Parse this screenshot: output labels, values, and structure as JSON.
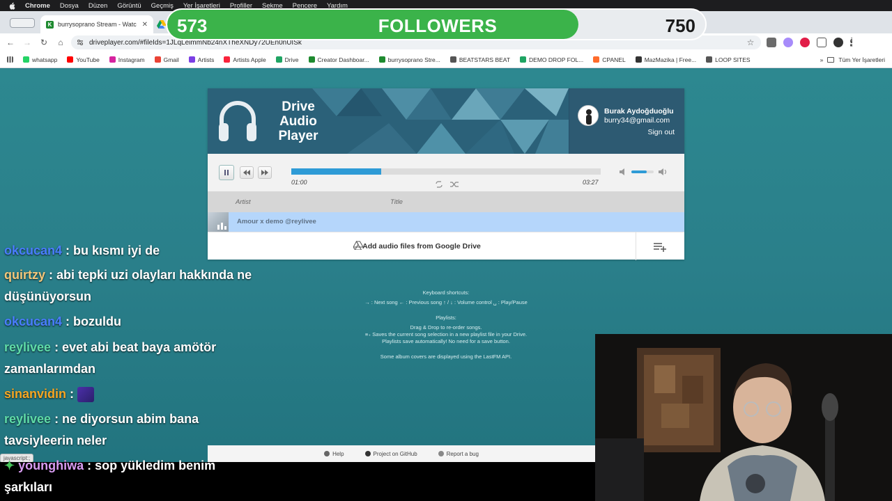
{
  "menubar": {
    "items": [
      "Chrome",
      "Dosya",
      "Düzen",
      "Görüntü",
      "Geçmiş",
      "Yer İşaretleri",
      "Profiller",
      "Sekme",
      "Pencere",
      "Yardım"
    ]
  },
  "browser": {
    "active_tab": {
      "label": "burrysoprano Stream - Watc",
      "favicon": "K"
    },
    "url": "driveplayer.com/#fileIds=1JLqLeimmNb24nXTheXNDy72UEn0nUISk",
    "bookmarks": [
      {
        "label": "whatsapp",
        "color": "#25d366"
      },
      {
        "label": "YouTube",
        "color": "#ff0000"
      },
      {
        "label": "Instagram",
        "color": "#d6249f"
      },
      {
        "label": "Gmail",
        "color": "#ea4335"
      },
      {
        "label": "Artists",
        "color": "#7b3fe4"
      },
      {
        "label": "Artists Apple",
        "color": "#fa243c"
      },
      {
        "label": "Drive",
        "color": "#1fa463"
      },
      {
        "label": "Creator Dashboar...",
        "color": "#1e8a2f"
      },
      {
        "label": "burrysoprano Stre...",
        "color": "#1e8a2f"
      },
      {
        "label": "BEATSTARS BEAT",
        "color": "#555555"
      },
      {
        "label": "DEMO DROP FOL...",
        "color": "#1fa463"
      },
      {
        "label": "CPANEL",
        "color": "#ff6c2c"
      },
      {
        "label": "MazMazika | Free...",
        "color": "#333333"
      },
      {
        "label": "LOOP SITES",
        "color": "#555555"
      }
    ],
    "all_bookmarks": "Tüm Yer İşaretleri"
  },
  "followers": {
    "current": "573",
    "label": "FOLLOWERS",
    "goal": "750",
    "progress": 0.764
  },
  "player": {
    "logo": {
      "line1": "Drive",
      "line2": "Audio",
      "line3": "Player"
    },
    "user": {
      "name": "Burak Aydoğduoğlu",
      "email": "burry34@gmail.com",
      "signout": "Sign out"
    },
    "time_current": "01:00",
    "time_total": "03:27",
    "progress": 0.29,
    "volume": 0.7,
    "columns": {
      "artist": "Artist",
      "title": "Title"
    },
    "tracks": [
      {
        "artist": "Amour x demo @reylivee",
        "title": ""
      }
    ],
    "add_label": "Add audio files from Google Drive"
  },
  "help": {
    "shortcuts_title": "Keyboard shortcuts:",
    "shortcuts_line": "→ : Next song  ← : Previous song  ↑ / ↓ : Volume control  ␣ : Play/Pause",
    "playlists_title": "Playlists:",
    "playlists_line1": "Drag & Drop to re-order songs.",
    "playlists_line2": "≡₊ Saves the current song selection in a new playlist file in your Drive.",
    "playlists_line3": "Playlists save automatically! No need for a save button.",
    "lastfm": "Some album covers are displayed using the LastFM API."
  },
  "footer": {
    "help": "Help",
    "github": "Project on GitHub",
    "bug": "Report a bug"
  },
  "status": "javascript:;",
  "chat": [
    {
      "user": "okcucan4",
      "color": "#4a7dff",
      "text": " : bu kısmı iyi de"
    },
    {
      "user": "quirtzy",
      "color": "#f3c77b",
      "text": " : abi tepki uzi olayları hakkında ne düşünüyorsun"
    },
    {
      "user": "okcucan4",
      "color": "#4a7dff",
      "text": " : bozuldu"
    },
    {
      "user": "reylivee",
      "color": "#5fdca8",
      "text": " : evet abi beat baya amötör zamanlarımdan"
    },
    {
      "user": "sinanvidin",
      "color": "#f5a623",
      "text": " : "
    },
    {
      "user": "reylivee",
      "color": "#5fdca8",
      "text": " : ne diyorsun abim bana tavsiyleerin neler"
    },
    {
      "user": "younghiwa",
      "color": "#d99cf2",
      "text": " : sop yükledim benim şarkıları"
    }
  ]
}
